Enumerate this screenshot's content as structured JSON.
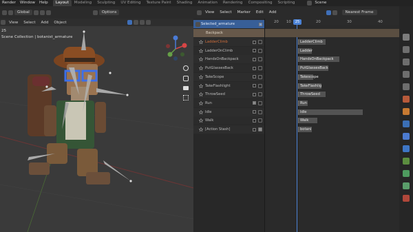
{
  "topbar": {
    "menus": [
      "Render",
      "Window",
      "Help"
    ],
    "workspaces": [
      "Layout",
      "Modeling",
      "Sculpting",
      "UV Editing",
      "Texture Paint",
      "Shading",
      "Animation",
      "Rendering",
      "Compositing",
      "Scripting"
    ],
    "active_workspace": "Layout",
    "scene_label": "Scene"
  },
  "viewport": {
    "orientation_label": "Global",
    "menus": [
      "View",
      "Select",
      "Add",
      "Object"
    ],
    "options_label": "Options",
    "frame_number": "25",
    "collection_path": "Scene Collection | botanist_armature",
    "gizmo_axes": {
      "x": "X",
      "y": "Y",
      "z": "Z"
    }
  },
  "dopesheet": {
    "menus": [
      "View",
      "Select",
      "Marker",
      "Edit",
      "Add"
    ],
    "snap_mode": "Nearest Frame",
    "frame_ticks": [
      "20",
      "10",
      "20",
      "30",
      "40"
    ],
    "current_frame": "25",
    "summary_row": "Selected_armature",
    "object_row": "Backpack",
    "actions": [
      {
        "name": "LadderClimb",
        "checked": false,
        "lock": false,
        "highlighted": true
      },
      {
        "name": "LadderOnClimb",
        "checked": false,
        "lock": false,
        "highlighted": false
      },
      {
        "name": "HandsOnBackpack",
        "checked": false,
        "lock": false,
        "highlighted": false
      },
      {
        "name": "PutGlassesBack",
        "checked": false,
        "lock": false,
        "highlighted": false
      },
      {
        "name": "TakeScope",
        "checked": false,
        "lock": false,
        "highlighted": false
      },
      {
        "name": "TakeFlashlight",
        "checked": false,
        "lock": false,
        "highlighted": false
      },
      {
        "name": "ThrowSeed",
        "checked": false,
        "lock": false,
        "highlighted": false
      },
      {
        "name": "Run",
        "checked": true,
        "lock": false,
        "highlighted": false
      },
      {
        "name": "Idle",
        "checked": false,
        "lock": false,
        "highlighted": false
      },
      {
        "name": "Walk",
        "checked": false,
        "lock": false,
        "highlighted": false
      },
      {
        "name": "[Action Stash]",
        "checked": false,
        "lock": true,
        "highlighted": false
      }
    ],
    "strips": [
      "LadderClimb",
      "Ladder",
      "HandsOnBackpack",
      "PutGlassesBack",
      "Takescope",
      "TakeFlashlig",
      "ThrowSeed",
      "Run",
      "Idle",
      "Walk",
      "botani"
    ]
  },
  "colors": {
    "accent_blue": "#4772b3",
    "summary_bg": "#385f98",
    "object_row_bg": "#67584a",
    "highlight_row": "#d06f3c",
    "playhead": "#4c83d6"
  }
}
